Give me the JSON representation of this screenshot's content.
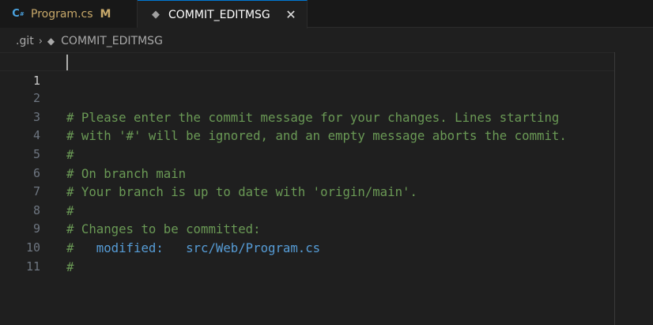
{
  "tabs": [
    {
      "icon": "csharp-file-icon",
      "label": "Program.cs",
      "status": "M",
      "active": false
    },
    {
      "icon": "git-icon",
      "label": "COMMIT_EDITMSG",
      "active": true,
      "close_glyph": "✕"
    }
  ],
  "breadcrumb": {
    "folder": ".git",
    "file": "COMMIT_EDITMSG"
  },
  "editor": {
    "current_line": 1,
    "lines": [
      {
        "number": "1",
        "text": ""
      },
      {
        "number": "2",
        "text": "# Please enter the commit message for your changes. Lines starting"
      },
      {
        "number": "3",
        "text": "# with '#' will be ignored, and an empty message aborts the commit."
      },
      {
        "number": "4",
        "text": "#"
      },
      {
        "number": "5",
        "text": "# On branch main"
      },
      {
        "number": "6",
        "text": "# Your branch is up to date with 'origin/main'."
      },
      {
        "number": "7",
        "text": "#"
      },
      {
        "number": "8",
        "text": "# Changes to be committed:"
      },
      {
        "number": "9",
        "text_prefix": "#   ",
        "text_modified": "modified:   src/Web/Program.cs"
      },
      {
        "number": "10",
        "text": "#"
      },
      {
        "number": "11",
        "text": ""
      }
    ]
  },
  "colors": {
    "comment": "#6a9955",
    "modified": "#569cd6",
    "accent": "#0078d4"
  }
}
